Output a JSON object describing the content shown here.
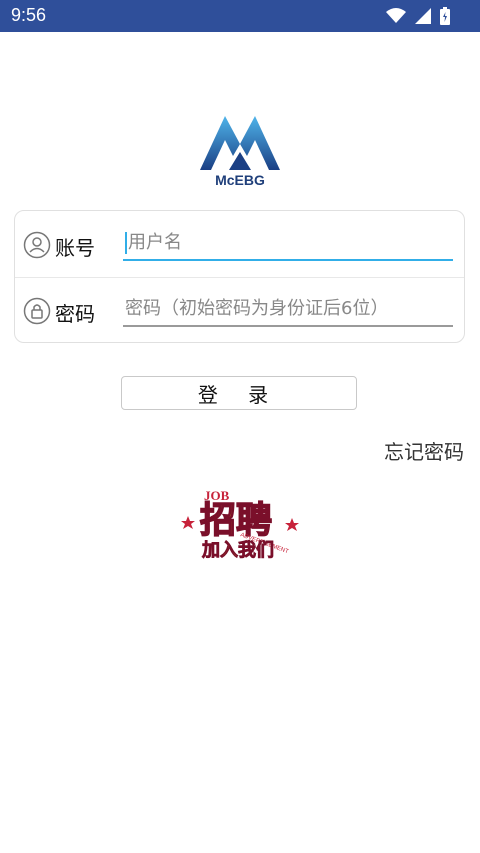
{
  "status_bar": {
    "time": "9:56"
  },
  "logo": {
    "text": "McEBG"
  },
  "form": {
    "account_label": "账号",
    "account_placeholder": "用户名",
    "password_label": "密码",
    "password_placeholder": "密码（初始密码为身份证后6位）"
  },
  "login_button": "登 录",
  "forgot_password": "忘记密码",
  "banner": {
    "job": "JOB",
    "main": "招聘",
    "sub": "加入我们",
    "ad": "ADVERTISEMENT"
  },
  "colors": {
    "status_bar": "#2f4f9a",
    "accent": "#31aee8",
    "logo_blue": "#1f6fb6"
  }
}
